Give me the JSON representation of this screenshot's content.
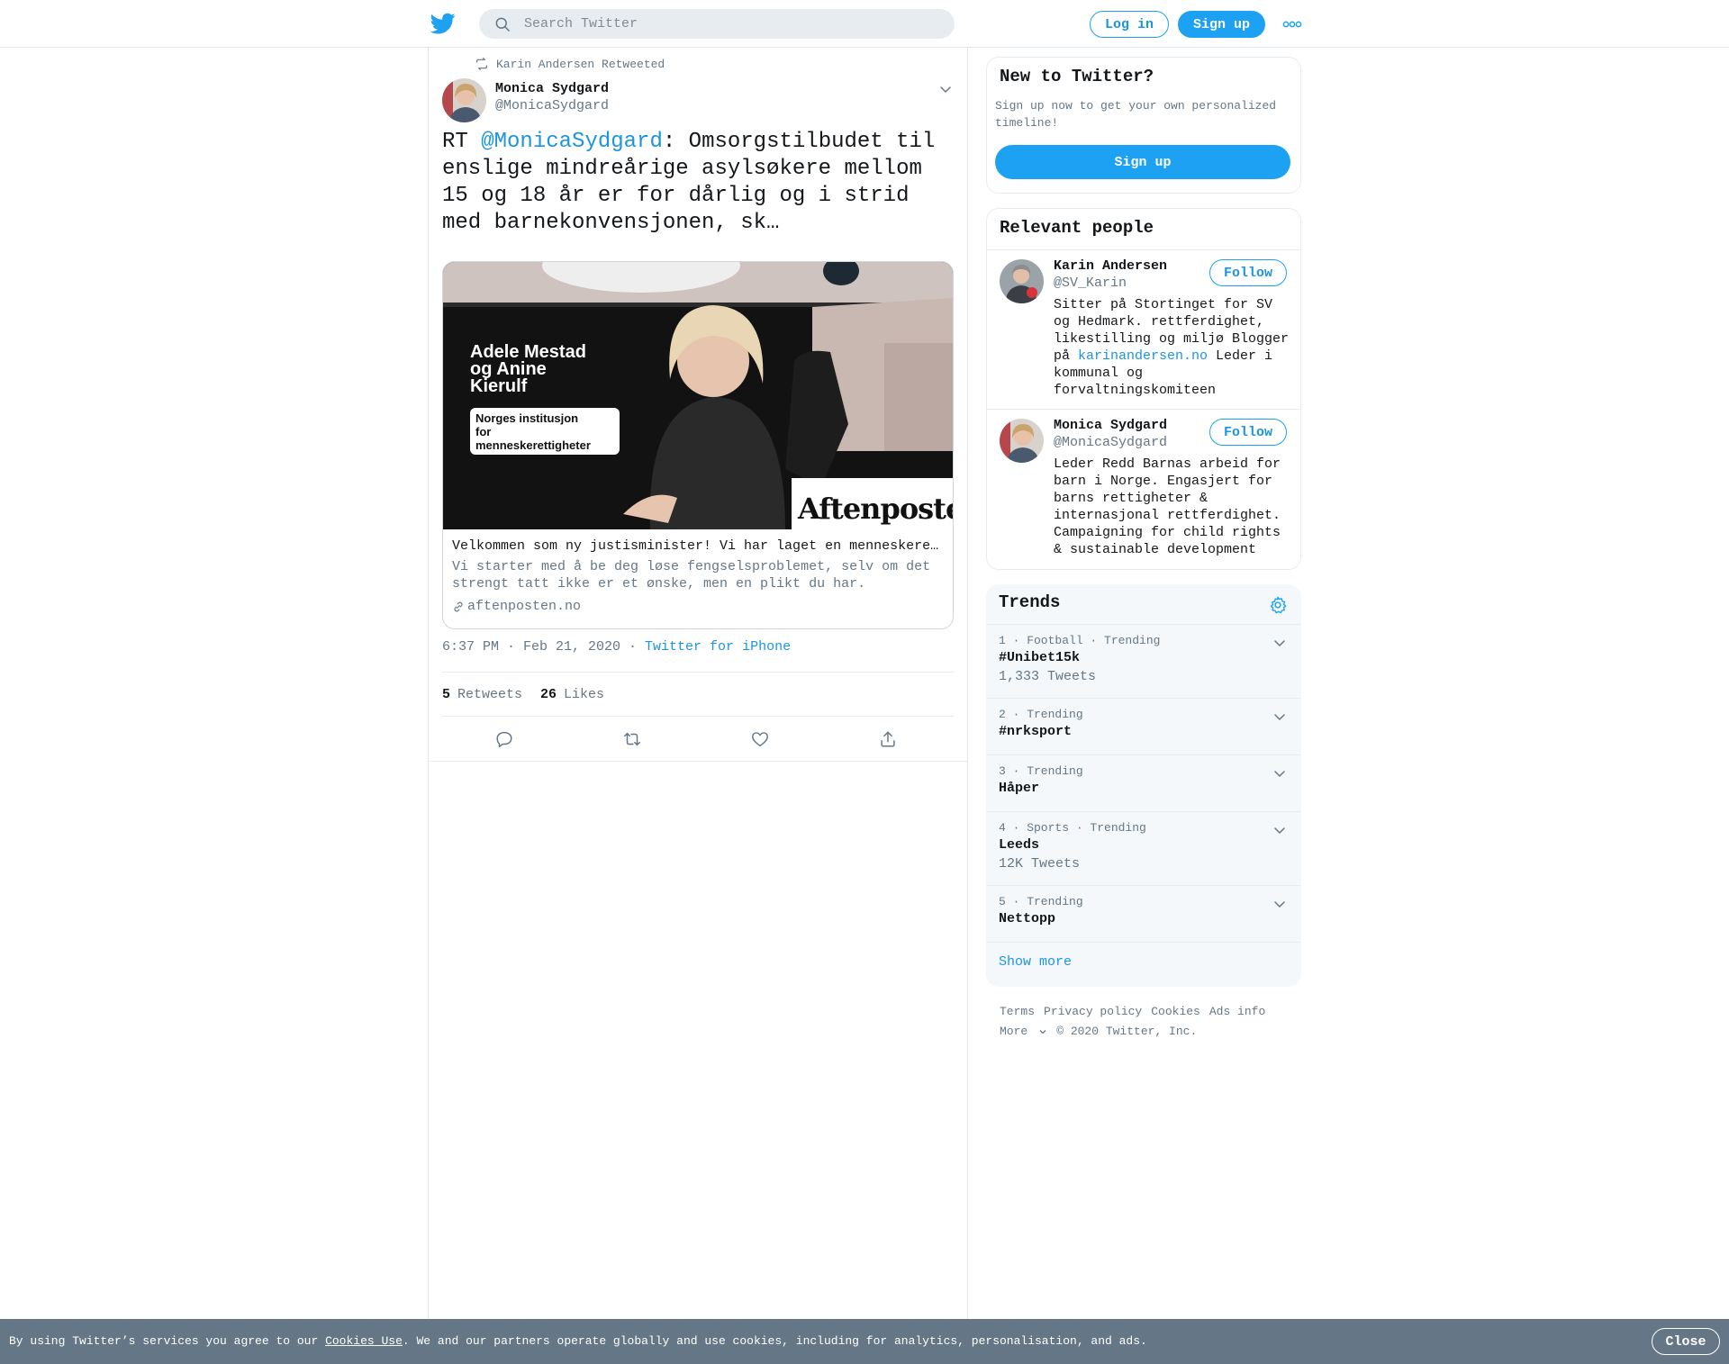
{
  "header": {
    "search_placeholder": "Search Twitter",
    "login_label": "Log in",
    "signup_label": "Sign up",
    "logo_icon": "twitter-bird-icon",
    "more_icon": "more-dots-icon"
  },
  "tweet": {
    "retweeted_by": "Karin Andersen Retweeted",
    "author_name": "Monica Sydgard",
    "author_handle": "@MonicaSydgard",
    "text_prefix": "RT ",
    "text_mention": "@MonicaSydgard",
    "text_body": ": Omsorgstilbudet til enslige mindreårige asylsøkere mellom 15 og 18 år er for dårlig og i strid med barnekonvensjonen, sk…",
    "card": {
      "image_heading_1": "Adele Mestad",
      "image_heading_2": "og Anine",
      "image_heading_3": "Kierulf",
      "image_badge_1": "Norges institusjon",
      "image_badge_2": "for",
      "image_badge_3": "menneskerettigheter",
      "image_brand": "Aftenposten",
      "title": "Velkommen som ny justisminister! Vi har laget en menneskerettighetsplan for deg",
      "description": "Vi starter med å be deg løse fengselsproblemet, selv om det strengt tatt ikke er et ønske, men en plikt du har.",
      "domain": "aftenposten.no"
    },
    "time": "6:37 PM · Feb 21, 2020 · ",
    "source": "Twitter for iPhone",
    "retweets_count": "5",
    "retweets_label": "Retweets",
    "likes_count": "26",
    "likes_label": "Likes"
  },
  "new_to_twitter": {
    "title": "New to Twitter?",
    "text": "Sign up now to get your own personalized timeline!",
    "button": "Sign up"
  },
  "relevant_people": {
    "title": "Relevant people",
    "people": [
      {
        "name": "Karin Andersen",
        "handle": "@SV_Karin",
        "follow": "Follow",
        "bio_before_link": "Sitter på Stortinget for SV og Hedmark. rettferdighet, likestilling og miljø Blogger på ",
        "bio_link": "karinandersen.no",
        "bio_after_link": " Leder i kommunal og forvaltningskomiteen"
      },
      {
        "name": "Monica Sydgard",
        "handle": "@MonicaSydgard",
        "follow": "Follow",
        "bio": "Leder Redd Barnas arbeid for barn i Norge. Engasjert for barns rettigheter & internasjonal rettferdighet. Campaigning for child rights & sustainable development"
      }
    ]
  },
  "trends": {
    "title": "Trends",
    "items": [
      {
        "meta": "1 · Football · Trending",
        "name": "#Unibet15k",
        "count": "1,333 Tweets"
      },
      {
        "meta": "2 · Trending",
        "name": "#nrksport",
        "count": ""
      },
      {
        "meta": "3 · Trending",
        "name": "Håper",
        "count": ""
      },
      {
        "meta": "4 · Sports · Trending",
        "name": "Leeds",
        "count": "12K Tweets"
      },
      {
        "meta": "5 · Trending",
        "name": "Nettopp",
        "count": ""
      }
    ],
    "show_more": "Show more"
  },
  "footer": {
    "terms": "Terms",
    "privacy": "Privacy policy",
    "cookies": "Cookies",
    "ads": "Ads info",
    "more": "More",
    "copyright": "© 2020 Twitter, Inc."
  },
  "cookie_bar": {
    "text_before": "By using Twitter’s services you agree to our ",
    "link": "Cookies Use",
    "text_after": ". We and our partners operate globally and use cookies, including for analytics, personalisation, and ads.",
    "close": "Close"
  },
  "colors": {
    "brand": "#1da1f2",
    "link": "#1b95e0",
    "muted": "#657786",
    "cookie_bar": "#657786"
  }
}
